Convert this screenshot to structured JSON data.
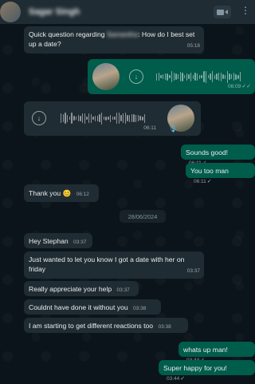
{
  "header": {
    "contact_name": "Sagar Singh",
    "video_icon": "video-camera-icon",
    "menu_icon": "more-options-icon"
  },
  "messages": {
    "m1": {
      "text_a": "Quick question regarding",
      "redacted": "Samantha",
      "text_b": "How do I best set up a date?",
      "time": "05:18"
    },
    "voice_out": {
      "time": "06:09"
    },
    "voice_in": {
      "time": "06:11"
    },
    "m4": {
      "text": "Sounds good!",
      "time": "06:11"
    },
    "m5": {
      "text": "You too man",
      "time": "06:11"
    },
    "m6": {
      "text": "Thank you 😊",
      "time": "06:12"
    },
    "date_divider": "28/06/2024",
    "m7": {
      "text": "Hey Stephan",
      "time": "03:37"
    },
    "m8": {
      "text": "Just wanted to let you know I got a date with her on friday",
      "time": "03:37"
    },
    "m9": {
      "text": "Really appreciate your help",
      "time": "03:37"
    },
    "m10": {
      "text": "Couldnt have done it without you",
      "time": "03:38"
    },
    "m11": {
      "text": "I am starting to get different reactions too",
      "time": "03:38"
    },
    "m12": {
      "text": "whats up man!",
      "time": "03:44"
    },
    "m13": {
      "text": "Super happy for you!",
      "time": "03:44"
    }
  },
  "colors": {
    "incoming": "#202c33",
    "outgoing": "#005c4b",
    "background": "#0b141a"
  }
}
